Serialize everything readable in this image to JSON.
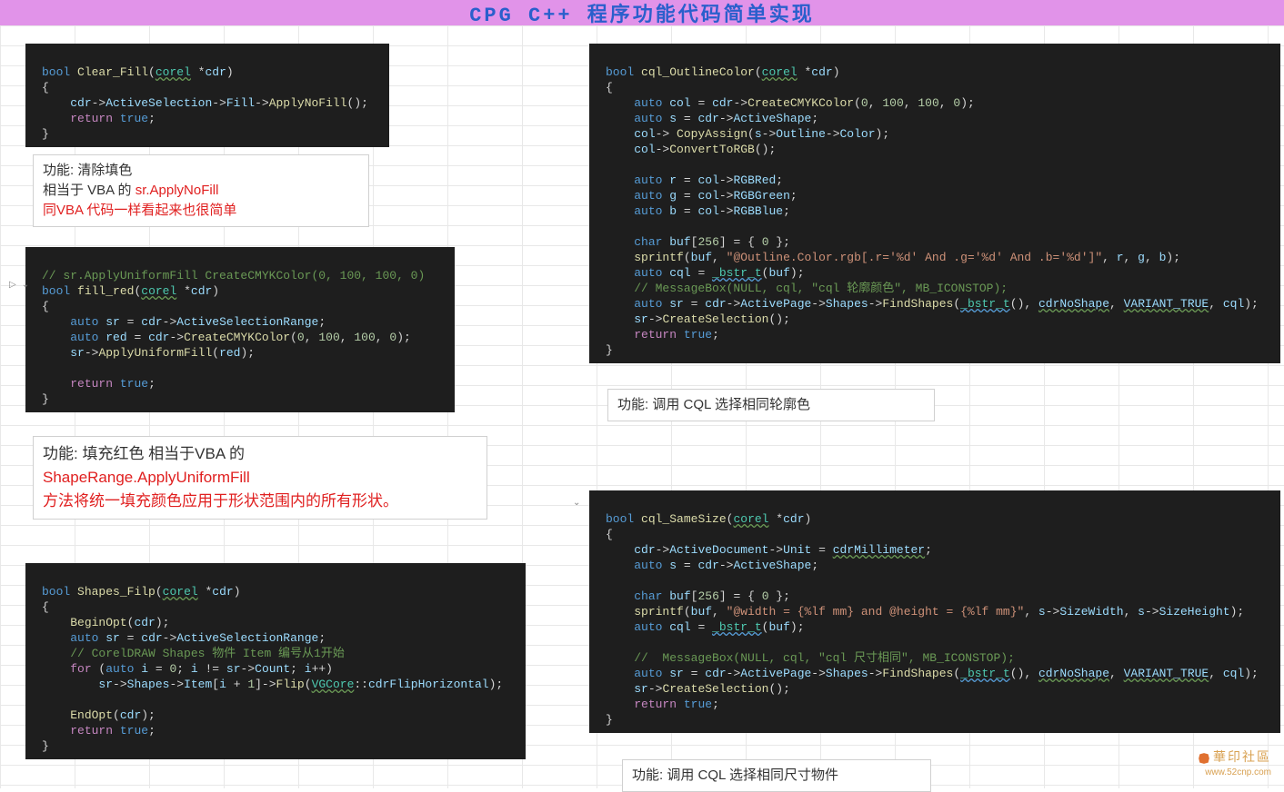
{
  "header": {
    "title": "CPG C++ 程序功能代码简单实现"
  },
  "blocks": {
    "clear_fill": {
      "l1_kw": "bool",
      "l1_fn": "Clear_Fill",
      "l1_ty": "corel",
      "l1_pm": "cdr",
      "l2": "{",
      "l3_var": "cdr",
      "l3_a": "->",
      "l3_m1": "ActiveSelection",
      "l3_b": "->",
      "l3_m2": "Fill",
      "l3_c": "->",
      "l3_fn": "ApplyNoFill",
      "l3_end": "();",
      "l4_kw": "return",
      "l4_v": "true",
      "l4_end": ";",
      "l5": "}"
    },
    "note1": {
      "l1": "功能: 清除填色",
      "l2a": "相当于 VBA 的  ",
      "l2b": "sr.ApplyNoFill",
      "l3": "同VBA 代码一样看起来也很简单"
    },
    "fill_red": {
      "c1": "// sr.ApplyUniformFill CreateCMYKColor(0, 100, 100, 0)",
      "l1_kw": "bool",
      "l1_fn": "fill_red",
      "l1_ty": "corel",
      "l1_pm": "cdr",
      "l2": "{",
      "l3_kw": "auto",
      "l3_v": "sr",
      "l3_eq": " = ",
      "l3_var": "cdr",
      "l3_a": "->",
      "l3_m": "ActiveSelectionRange",
      "l3_end": ";",
      "l4_kw": "auto",
      "l4_v": "red",
      "l4_eq": " = ",
      "l4_var": "cdr",
      "l4_a": "->",
      "l4_fn": "CreateCMYKColor",
      "l4_args": "(",
      "l4_n1": "0",
      "l4_c": ", ",
      "l4_n2": "100",
      "l4_c2": ", ",
      "l4_n3": "100",
      "l4_c3": ", ",
      "l4_n4": "0",
      "l4_end": ");",
      "l5_v": "sr",
      "l5_a": "->",
      "l5_fn": "ApplyUniformFill",
      "l5_args": "(",
      "l5_p": "red",
      "l5_end": ");",
      "l6": "",
      "l7_kw": "return",
      "l7_v": "true",
      "l7_end": ";",
      "l8": "}"
    },
    "note2": {
      "l1a": "功能: 填充红色    相当于VBA 的",
      "l2": "ShapeRange.ApplyUniformFill",
      "l3": "方法将统一填充颜色应用于形状范围内的所有形状。"
    },
    "shapes_flip": {
      "l1_kw": "bool",
      "l1_fn": "Shapes_Filp",
      "l1_ty": "corel",
      "l1_pm": "cdr",
      "l2": "{",
      "l3_fn": "BeginOpt",
      "l3_args": "(",
      "l3_p": "cdr",
      "l3_end": ");",
      "l4_kw": "auto",
      "l4_v": "sr",
      "l4_eq": " = ",
      "l4_var": "cdr",
      "l4_a": "->",
      "l4_m": "ActiveSelectionRange",
      "l4_end": ";",
      "l5": "// CorelDRAW Shapes 物件 Item 编号从1开始",
      "l6_kw": "for",
      "l6_a": " (",
      "l6_auto": "auto",
      "l6_i": " i",
      "l6_eq": " = ",
      "l6_n": "0",
      "l6_sc": "; ",
      "l6_i2": "i",
      "l6_ne": " != ",
      "l6_sr": "sr",
      "l6_ar": "->",
      "l6_cnt": "Count",
      "l6_sc2": "; ",
      "l6_i3": "i",
      "l6_pp": "++)",
      "l7_sr": "sr",
      "l7_a": "->",
      "l7_sh": "Shapes",
      "l7_b": "->",
      "l7_it": "Item",
      "l7_br": "[",
      "l7_i": "i",
      "l7_pl": " + ",
      "l7_n": "1",
      "l7_br2": "]->",
      "l7_fn": "Flip",
      "l7_o": "(",
      "l7_ns": "VGCore",
      "l7_cc": "::",
      "l7_en": "cdrFlipHorizontal",
      "l7_end": ");",
      "l8": "",
      "l9_fn": "EndOpt",
      "l9_args": "(",
      "l9_p": "cdr",
      "l9_end": ");",
      "l10_kw": "return",
      "l10_v": "true",
      "l10_end": ";",
      "l11": "}"
    },
    "outline": {
      "l1_kw": "bool",
      "l1_fn": "cql_OutlineColor",
      "l1_ty": "corel",
      "l1_pm": "cdr",
      "l2": "{",
      "l3_kw": "auto",
      "l3_v": "col",
      "l3_eq": " = ",
      "l3_var": "cdr",
      "l3_a": "->",
      "l3_fn": "CreateCMYKColor",
      "l3_args": "(",
      "l3_n1": "0",
      "l3_c": ", ",
      "l3_n2": "100",
      "l3_c2": ", ",
      "l3_n3": "100",
      "l3_c3": ", ",
      "l3_n4": "0",
      "l3_end": ");",
      "l4_kw": "auto",
      "l4_v": "s",
      "l4_eq": " = ",
      "l4_var": "cdr",
      "l4_a": "->",
      "l4_m": "ActiveShape",
      "l4_end": ";",
      "l5_v": "col",
      "l5_a": "-> ",
      "l5_fn": "CopyAssign",
      "l5_o": "(",
      "l5_s": "s",
      "l5_b": "->",
      "l5_out": "Outline",
      "l5_c": "->",
      "l5_col": "Color",
      "l5_end": ");",
      "l6_v": "col",
      "l6_a": "->",
      "l6_fn": "ConvertToRGB",
      "l6_end": "();",
      "l7": "",
      "l8_kw": "auto",
      "l8_v": "r",
      "l8_eq": " = ",
      "l8_col": "col",
      "l8_a": "->",
      "l8_m": "RGBRed",
      "l8_end": ";",
      "l9_kw": "auto",
      "l9_v": "g",
      "l9_eq": " = ",
      "l9_col": "col",
      "l9_a": "->",
      "l9_m": "RGBGreen",
      "l9_end": ";",
      "l10_kw": "auto",
      "l10_v": "b",
      "l10_eq": " = ",
      "l10_col": "col",
      "l10_a": "->",
      "l10_m": "RGBBlue",
      "l10_end": ";",
      "l11": "",
      "l12_kw": "char",
      "l12_v": "buf",
      "l12_br": "[",
      "l12_n": "256",
      "l12_br2": "] = { ",
      "l12_z": "0",
      "l12_end": " };",
      "l13_fn": "sprintf",
      "l13_a": "(",
      "l13_buf": "buf",
      "l13_c": ", ",
      "l13_str": "\"@Outline.Color.rgb[.r='%d' And .g='%d' And .b='%d']\"",
      "l13_c2": ", ",
      "l13_r": "r",
      "l13_c3": ", ",
      "l13_g": "g",
      "l13_c4": ", ",
      "l13_b": "b",
      "l13_end": ");",
      "l14_kw": "auto",
      "l14_v": "cql",
      "l14_eq": " = ",
      "l14_bstr": "_bstr_t",
      "l14_a": "(",
      "l14_buf": "buf",
      "l14_end": ");",
      "l15": "// MessageBox(NULL, cql, \"cql 轮廓颜色\", MB_ICONSTOP);",
      "l16_kw": "auto",
      "l16_v": "sr",
      "l16_eq": " = ",
      "l16_var": "cdr",
      "l16_a": "->",
      "l16_ap": "ActivePage",
      "l16_b": "->",
      "l16_sh": "Shapes",
      "l16_c": "->",
      "l16_fn": "FindShapes",
      "l16_o": "(",
      "l16_bstr": "_bstr_t",
      "l16_p": "(), ",
      "l16_cns": "cdrNoShape",
      "l16_c2": ", ",
      "l16_vt": "VARIANT_TRUE",
      "l16_c3": ", ",
      "l16_cql": "cql",
      "l16_end": ");",
      "l17_v": "sr",
      "l17_a": "->",
      "l17_fn": "CreateSelection",
      "l17_end": "();",
      "l18_kw": "return",
      "l18_v": "true",
      "l18_end": ";",
      "l19": "}"
    },
    "note3": {
      "l1": "功能: 调用 CQL 选择相同轮廓色"
    },
    "samesize": {
      "l1_kw": "bool",
      "l1_fn": "cql_SameSize",
      "l1_ty": "corel",
      "l1_pm": "cdr",
      "l2": "{",
      "l3_v": "cdr",
      "l3_a": "->",
      "l3_ad": "ActiveDocument",
      "l3_b": "->",
      "l3_u": "Unit",
      "l3_eq": " = ",
      "l3_en": "cdrMillimeter",
      "l3_end": ";",
      "l4_kw": "auto",
      "l4_v": "s",
      "l4_eq": " = ",
      "l4_var": "cdr",
      "l4_a": "->",
      "l4_m": "ActiveShape",
      "l4_end": ";",
      "l5": "",
      "l6_kw": "char",
      "l6_v": "buf",
      "l6_br": "[",
      "l6_n": "256",
      "l6_br2": "] = { ",
      "l6_z": "0",
      "l6_end": " };",
      "l7_fn": "sprintf",
      "l7_a": "(",
      "l7_buf": "buf",
      "l7_c": ", ",
      "l7_str": "\"@width = {%lf mm} and @height = {%lf mm}\"",
      "l7_c2": ", ",
      "l7_s": "s",
      "l7_ar": "->",
      "l7_sw": "SizeWidth",
      "l7_c3": ", ",
      "l7_s2": "s",
      "l7_ar2": "->",
      "l7_sh": "SizeHeight",
      "l7_end": ");",
      "l8_kw": "auto",
      "l8_v": "cql",
      "l8_eq": " = ",
      "l8_bstr": "_bstr_t",
      "l8_a": "(",
      "l8_buf": "buf",
      "l8_end": ");",
      "l9": "",
      "l10": "//  MessageBox(NULL, cql, \"cql 尺寸相同\", MB_ICONSTOP);",
      "l11_kw": "auto",
      "l11_v": "sr",
      "l11_eq": " = ",
      "l11_var": "cdr",
      "l11_a": "->",
      "l11_ap": "ActivePage",
      "l11_b": "->",
      "l11_sh": "Shapes",
      "l11_c": "->",
      "l11_fn": "FindShapes",
      "l11_o": "(",
      "l11_bstr": "_bstr_t",
      "l11_p": "(), ",
      "l11_cns": "cdrNoShape",
      "l11_c2": ", ",
      "l11_vt": "VARIANT_TRUE",
      "l11_c3": ", ",
      "l11_cql": "cql",
      "l11_end": ");",
      "l12_v": "sr",
      "l12_a": "->",
      "l12_fn": "CreateSelection",
      "l12_end": "();",
      "l13_kw": "return",
      "l13_v": "true",
      "l13_end": ";",
      "l14": "}"
    },
    "note4": {
      "l1": "功能: 调用 CQL 选择相同尺寸物件"
    }
  },
  "watermark": {
    "cn": "華印社區",
    "url": "www.52cnp.com"
  }
}
